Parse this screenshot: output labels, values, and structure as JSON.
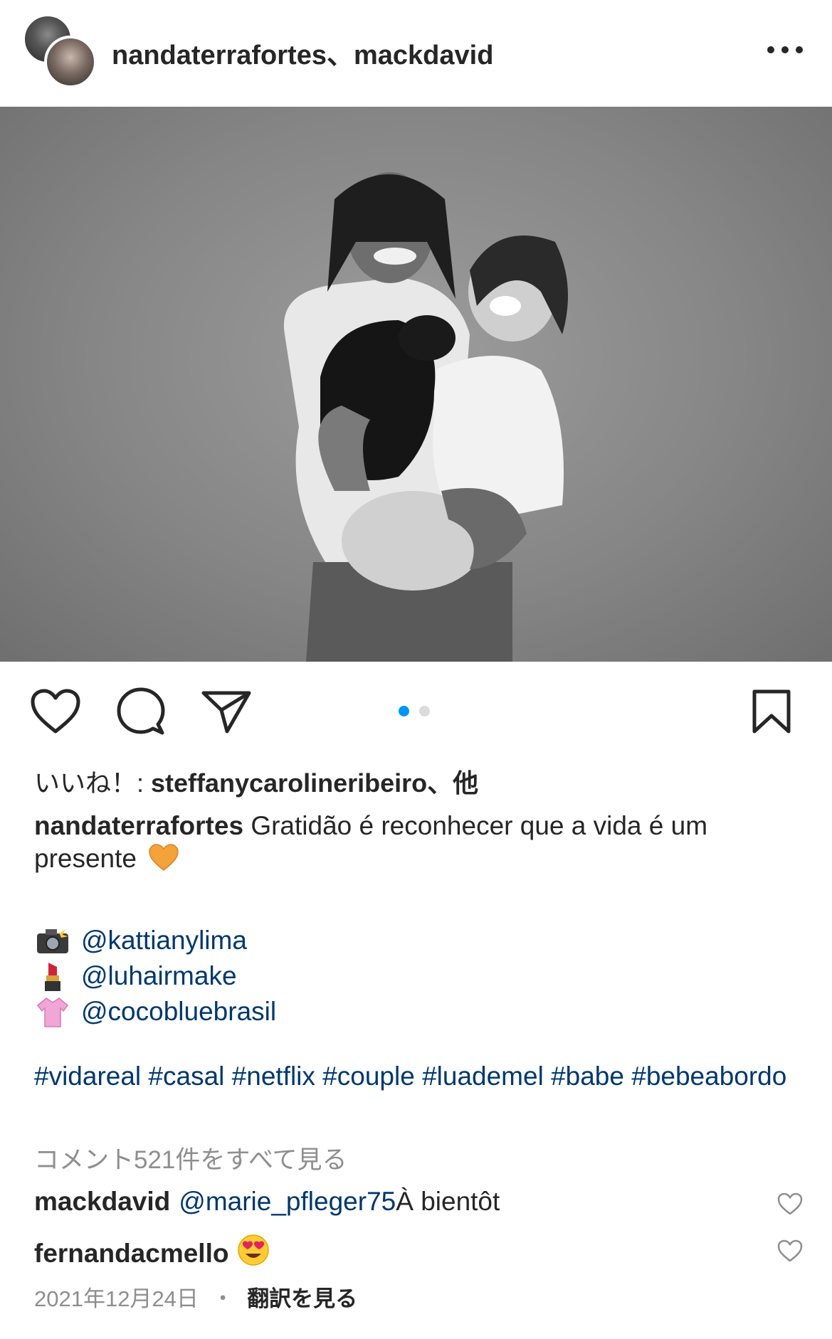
{
  "header": {
    "title": "nandaterrafortes、mackdavid"
  },
  "post": {
    "carousel": {
      "count": 2,
      "active_index": 0
    }
  },
  "likes": {
    "prefix": "いいね！: ",
    "user": "steffanycarolineribeiro、他"
  },
  "caption": {
    "username": "nandaterrafortes",
    "text": "Gratidão é reconhecer que a vida é um presente",
    "heart_emoji": "orange-heart",
    "credits": [
      {
        "emoji": "camera-flash-emoji",
        "mention": "@kattianylima"
      },
      {
        "emoji": "lipstick-emoji",
        "mention": "@luhairmake"
      },
      {
        "emoji": "blouse-emoji",
        "mention": "@cocobluebrasil"
      }
    ],
    "hashtags": "#vidareal #casal #netflix #couple #luademel #babe #bebeabordo"
  },
  "view_all_comments": "コメント521件をすべて見る",
  "comments": [
    {
      "user": "mackdavid",
      "mention": "@marie_pfleger75",
      "text": " À bientôt"
    },
    {
      "user": "fernandacmello",
      "emoji": "heart-eyes-emoji"
    }
  ],
  "meta": {
    "date": "2021年12月24日",
    "separator": "・",
    "translate": "翻訳を見る"
  },
  "colors": {
    "link": "#00376b",
    "accent": "#0095f6",
    "muted": "#8e8e8e",
    "text": "#262626"
  }
}
